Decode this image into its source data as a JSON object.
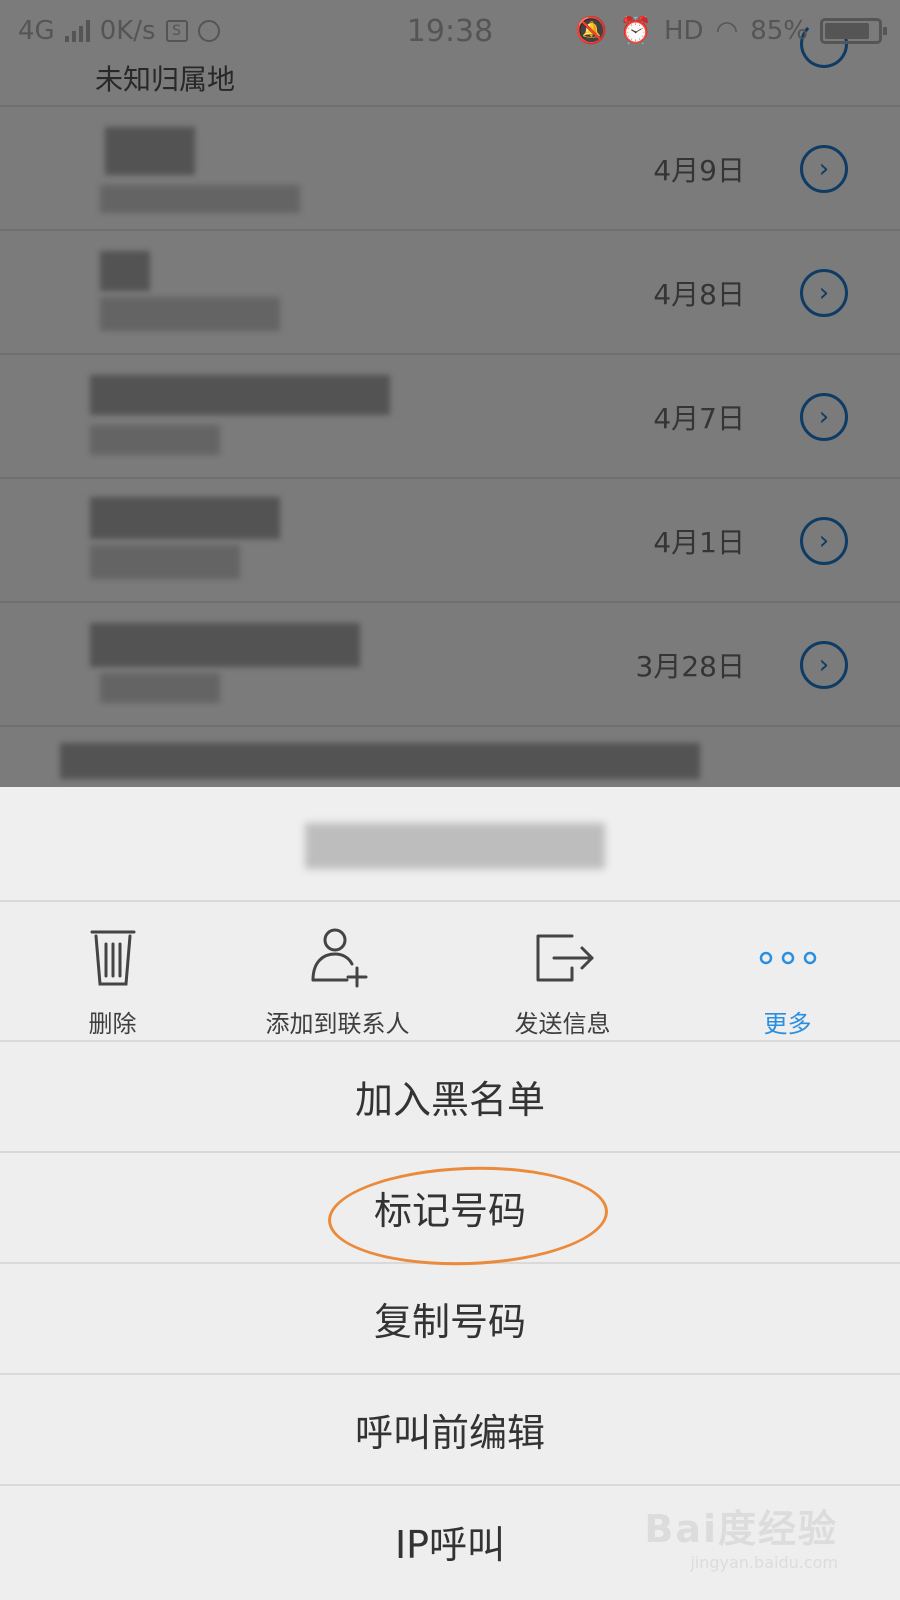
{
  "status_bar": {
    "network": "4G",
    "speed": "0K/s",
    "time": "19:38",
    "hd": "HD",
    "battery": "85%",
    "battery_level": 0.85
  },
  "call_log": {
    "first_row_location": "未知归属地",
    "rows": [
      {
        "date": "4月9日"
      },
      {
        "date": "4月8日"
      },
      {
        "date": "4月7日"
      },
      {
        "date": "4月1日"
      },
      {
        "date": "3月28日"
      }
    ]
  },
  "actions": [
    {
      "label": "删除",
      "icon": "trash-icon"
    },
    {
      "label": "添加到联系人",
      "icon": "add-contact-icon"
    },
    {
      "label": "发送信息",
      "icon": "send-message-icon"
    },
    {
      "label": "更多",
      "icon": "more-dots-icon"
    }
  ],
  "menu": {
    "blacklist": "加入黑名单",
    "mark_number": "标记号码",
    "copy_number": "复制号码",
    "edit_before_call": "呼叫前编辑",
    "ip_call": "IP呼叫"
  },
  "colors": {
    "accent": "#2a8fe0",
    "chevron": "#1d78c9",
    "highlight": "#ea8a3a"
  },
  "watermark": {
    "main": "Bai度经验",
    "sub": "jingyan.baidu.com"
  }
}
